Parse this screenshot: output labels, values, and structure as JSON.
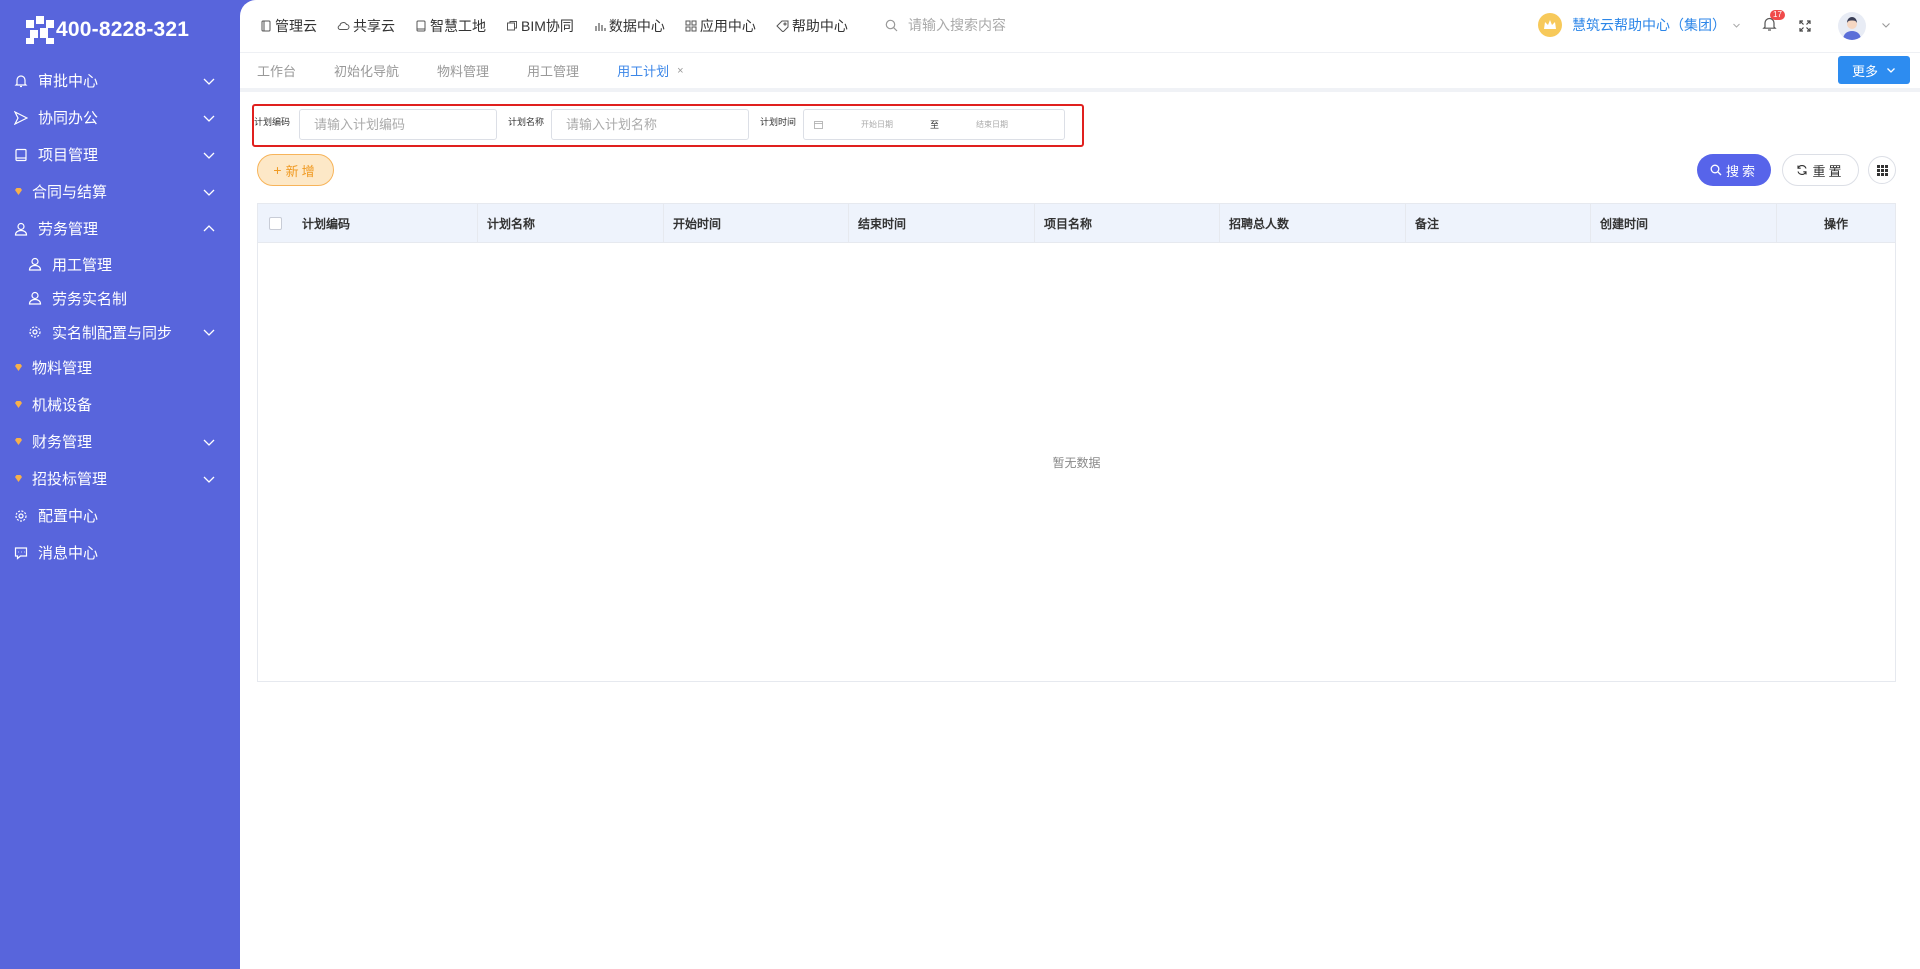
{
  "brand": {
    "phone": "400-8228-321"
  },
  "sidebar": {
    "items": [
      {
        "label": "审批中心",
        "icon": "bell-icon",
        "expandable": true
      },
      {
        "label": "协同办公",
        "icon": "send-icon",
        "expandable": true
      },
      {
        "label": "项目管理",
        "icon": "book-icon",
        "expandable": true
      },
      {
        "label": "合同与结算",
        "icon": "diamond-icon",
        "expandable": true
      },
      {
        "label": "劳务管理",
        "icon": "user-icon",
        "expandable": true,
        "expanded": true
      },
      {
        "label": "用工管理",
        "icon": "user-icon",
        "sub": true
      },
      {
        "label": "劳务实名制",
        "icon": "user-icon",
        "sub": true
      },
      {
        "label": "实名制配置与同步",
        "icon": "gear-icon",
        "sub": true,
        "expandable": true
      },
      {
        "label": "物料管理",
        "icon": "diamond-icon"
      },
      {
        "label": "机械设备",
        "icon": "diamond-icon"
      },
      {
        "label": "财务管理",
        "icon": "diamond-icon",
        "expandable": true
      },
      {
        "label": "招投标管理",
        "icon": "diamond-icon",
        "expandable": true
      },
      {
        "label": "配置中心",
        "icon": "gear-icon"
      },
      {
        "label": "消息中心",
        "icon": "message-icon"
      }
    ]
  },
  "topnav": {
    "items": [
      {
        "label": "管理云",
        "icon": "doc-icon"
      },
      {
        "label": "共享云",
        "icon": "cloud-icon"
      },
      {
        "label": "智慧工地",
        "icon": "book-icon"
      },
      {
        "label": "BIM协同",
        "icon": "cube-icon"
      },
      {
        "label": "数据中心",
        "icon": "chart-icon"
      },
      {
        "label": "应用中心",
        "icon": "grid-icon"
      },
      {
        "label": "帮助中心",
        "icon": "tag-icon"
      }
    ],
    "search_placeholder": "请输入搜索内容",
    "org_name": "慧筑云帮助中心（集团）",
    "notification_count": "17"
  },
  "tabs": {
    "items": [
      {
        "label": "工作台"
      },
      {
        "label": "初始化导航"
      },
      {
        "label": "物料管理"
      },
      {
        "label": "用工管理"
      },
      {
        "label": "用工计划",
        "active": true,
        "closable": true
      }
    ],
    "more_label": "更多"
  },
  "filters": {
    "code_label": "计划编码",
    "code_placeholder": "请输入计划编码",
    "name_label": "计划名称",
    "name_placeholder": "请输入计划名称",
    "time_label": "计划时间",
    "start_placeholder": "开始日期",
    "range_sep": "至",
    "end_placeholder": "结束日期"
  },
  "actions": {
    "add_label": "新增",
    "search_label": "搜索",
    "reset_label": "重置"
  },
  "table": {
    "columns": [
      "计划编码",
      "计划名称",
      "开始时间",
      "结束时间",
      "项目名称",
      "招聘总人数",
      "备注",
      "创建时间",
      "操作"
    ],
    "empty_text": "暂无数据"
  },
  "colors": {
    "sidebar_bg": "#5865dc",
    "accent_blue": "#2d8cf0",
    "search_button": "#5764ea",
    "add_button_bg": "#fde8c7",
    "highlight_border": "#e0201e"
  }
}
